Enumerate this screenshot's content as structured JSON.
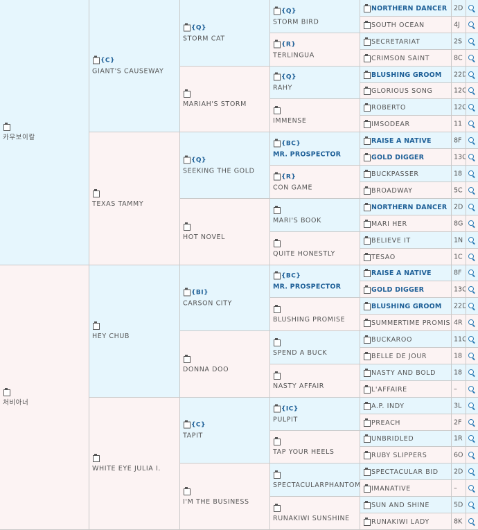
{
  "pedigree": {
    "sire": {
      "name": "카우보이칼",
      "tag": "",
      "sire": {
        "name": "GIANT'S CAUSEWAY",
        "tag": "{C}",
        "sire": {
          "name": "STORM CAT",
          "tag": "{Q}",
          "sire": {
            "name": "STORM BIRD",
            "tag": "{Q}",
            "sire": {
              "name": "NORTHERN DANCER",
              "code": "2D",
              "bold": true
            },
            "dam": {
              "name": "SOUTH OCEAN",
              "code": "4J",
              "bold": false
            }
          },
          "dam": {
            "name": "TERLINGUA",
            "tag": "{R}",
            "sire": {
              "name": "SECRETARIAT",
              "code": "2S",
              "bold": false
            },
            "dam": {
              "name": "CRIMSON SAINT",
              "code": "8C",
              "bold": false
            }
          }
        },
        "dam": {
          "name": "MARIAH'S STORM",
          "tag": "",
          "sire": {
            "name": "RAHY",
            "tag": "{Q}",
            "sire": {
              "name": "BLUSHING GROOM",
              "code": "22D",
              "bold": true
            },
            "dam": {
              "name": "GLORIOUS SONG",
              "code": "12C",
              "bold": false
            }
          },
          "dam": {
            "name": "IMMENSE",
            "tag": "",
            "sire": {
              "name": "ROBERTO",
              "code": "12C",
              "bold": false
            },
            "dam": {
              "name": "IMSODEAR",
              "code": "11",
              "bold": false
            }
          }
        }
      },
      "dam": {
        "name": "TEXAS TAMMY",
        "tag": "",
        "sire": {
          "name": "SEEKING THE GOLD",
          "tag": "{Q}",
          "sire": {
            "name": "MR. PROSPECTOR",
            "tag": "{BC}",
            "bold": true,
            "sire": {
              "name": "RAISE A NATIVE",
              "code": "8F",
              "bold": true
            },
            "dam": {
              "name": "GOLD DIGGER",
              "code": "13C",
              "bold": true
            }
          },
          "dam": {
            "name": "CON GAME",
            "tag": "{R}",
            "sire": {
              "name": "BUCKPASSER",
              "code": "18",
              "bold": false
            },
            "dam": {
              "name": "BROADWAY",
              "code": "5C",
              "bold": false
            }
          }
        },
        "dam": {
          "name": "HOT NOVEL",
          "tag": "",
          "sire": {
            "name": "MARI'S BOOK",
            "tag": "",
            "sire": {
              "name": "NORTHERN DANCER",
              "code": "2D",
              "bold": true
            },
            "dam": {
              "name": "MARI HER",
              "code": "8G",
              "bold": false
            }
          },
          "dam": {
            "name": "QUITE HONESTLY",
            "tag": "",
            "sire": {
              "name": "BELIEVE IT",
              "code": "1N",
              "bold": false
            },
            "dam": {
              "name": "TESAO",
              "code": "1C",
              "bold": false
            }
          }
        }
      }
    },
    "dam": {
      "name": "처비아너",
      "tag": "",
      "sire": {
        "name": "HEY CHUB",
        "tag": "",
        "sire": {
          "name": "CARSON CITY",
          "tag": "{BI}",
          "sire": {
            "name": "MR. PROSPECTOR",
            "tag": "{BC}",
            "bold": true,
            "sire": {
              "name": "RAISE A NATIVE",
              "code": "8F",
              "bold": true
            },
            "dam": {
              "name": "GOLD DIGGER",
              "code": "13C",
              "bold": true
            }
          },
          "dam": {
            "name": "BLUSHING PROMISE",
            "tag": "",
            "sire": {
              "name": "BLUSHING GROOM",
              "code": "22D",
              "bold": true
            },
            "dam": {
              "name": "SUMMERTIME PROMISE",
              "code": "4R",
              "bold": false
            }
          }
        },
        "dam": {
          "name": "DONNA DOO",
          "tag": "",
          "sire": {
            "name": "SPEND A BUCK",
            "tag": "",
            "sire": {
              "name": "BUCKAROO",
              "code": "11C",
              "bold": false
            },
            "dam": {
              "name": "BELLE DE JOUR",
              "code": "18",
              "bold": false
            }
          },
          "dam": {
            "name": "NASTY AFFAIR",
            "tag": "",
            "sire": {
              "name": "NASTY AND BOLD",
              "code": "18",
              "bold": false
            },
            "dam": {
              "name": "L'AFFAIRE",
              "code": "–",
              "bold": false
            }
          }
        }
      },
      "dam": {
        "name": "WHITE EYE JULIA I.",
        "tag": "",
        "sire": {
          "name": "TAPIT",
          "tag": "{C}",
          "sire": {
            "name": "PULPIT",
            "tag": "{IC}",
            "sire": {
              "name": "A.P. INDY",
              "code": "3L",
              "bold": false
            },
            "dam": {
              "name": "PREACH",
              "code": "2F",
              "bold": false
            }
          },
          "dam": {
            "name": "TAP YOUR HEELS",
            "tag": "",
            "sire": {
              "name": "UNBRIDLED",
              "code": "1R",
              "bold": false
            },
            "dam": {
              "name": "RUBY SLIPPERS",
              "code": "6O",
              "bold": false
            }
          }
        },
        "dam": {
          "name": "I'M THE BUSINESS",
          "tag": "",
          "sire": {
            "name": "SPECTACULARPHANTOM",
            "tag": "",
            "sire": {
              "name": "SPECTACULAR BID",
              "code": "2D",
              "bold": false
            },
            "dam": {
              "name": "IMANATIVE",
              "code": "–",
              "bold": false
            }
          },
          "dam": {
            "name": "RUNAKIWI SUNSHINE",
            "tag": "",
            "sire": {
              "name": "SUN AND SHINE",
              "code": "5D",
              "bold": false
            },
            "dam": {
              "name": "RUNAKIWI LADY",
              "code": "8K",
              "bold": false
            }
          }
        }
      }
    }
  }
}
